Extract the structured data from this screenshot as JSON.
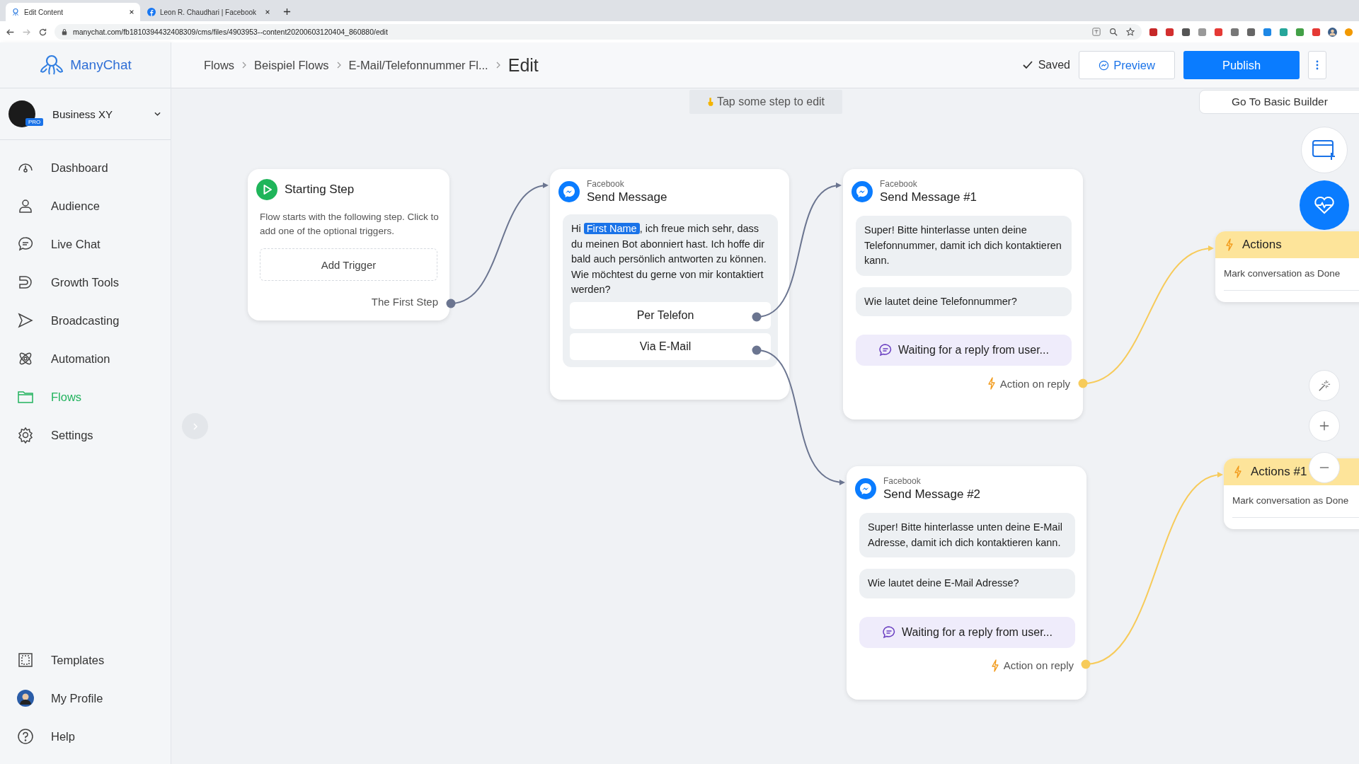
{
  "browser": {
    "tabs": [
      {
        "title": "Edit Content",
        "selected": true
      },
      {
        "title": "Leon R. Chaudhari | Facebook",
        "selected": false
      }
    ],
    "url": "manychat.com/fb1810394432408309/cms/files/4903953--content20200603120404_860880/edit"
  },
  "sidebar": {
    "brand": "ManyChat",
    "account": {
      "name": "Business XY",
      "badge": "PRO"
    },
    "items": [
      {
        "label": "Dashboard",
        "selected": false
      },
      {
        "label": "Audience",
        "selected": false
      },
      {
        "label": "Live Chat",
        "selected": false
      },
      {
        "label": "Growth Tools",
        "selected": false
      },
      {
        "label": "Broadcasting",
        "selected": false
      },
      {
        "label": "Automation",
        "selected": false
      },
      {
        "label": "Flows",
        "selected": true
      },
      {
        "label": "Settings",
        "selected": false
      }
    ],
    "bottom_items": [
      {
        "label": "Templates"
      },
      {
        "label": "My Profile"
      },
      {
        "label": "Help"
      }
    ]
  },
  "header": {
    "breadcrumbs": [
      "Flows",
      "Beispiel Flows",
      "E-Mail/Telefonnummer Fl..."
    ],
    "current": "Edit",
    "status": "Saved",
    "preview": "Preview",
    "publish": "Publish"
  },
  "canvas": {
    "hint": "Tap some step to edit",
    "basic_builder": "Go To Basic Builder",
    "nodes": [
      {
        "kind": "start",
        "title": "Starting Step",
        "description": "Flow starts with the following step. Click to add one of the optional triggers.",
        "trigger": "Add Trigger",
        "output": "The First Step"
      },
      {
        "kind": "message",
        "channel": "Facebook",
        "title": "Send Message",
        "blocks": [
          {
            "kind": "text",
            "parts": [
              {
                "kind": "plain",
                "text": "Hi "
              },
              {
                "kind": "variable",
                "text": "First Name"
              },
              {
                "kind": "plain",
                "text": ", ich freue mich sehr, dass du meinen Bot abonniert hast. Ich hoffe dir bald auch persönlich antworten zu können. Wie möchtest du gerne von mir kontaktiert werden?"
              }
            ],
            "buttons": [
              "Per Telefon",
              "Via E-Mail"
            ]
          }
        ]
      },
      {
        "kind": "message",
        "channel": "Facebook",
        "title": "Send Message #1",
        "blocks": [
          {
            "kind": "text",
            "parts": [
              {
                "kind": "plain",
                "text": "Super! Bitte hinterlasse unten deine Telefonnummer, damit ich dich kontaktieren kann."
              }
            ]
          },
          {
            "kind": "text",
            "parts": [
              {
                "kind": "plain",
                "text": "Wie lautet deine Telefonnummer?"
              }
            ]
          },
          {
            "kind": "waiting",
            "text": "Waiting for a reply from user..."
          }
        ],
        "footer": "Action on reply"
      },
      {
        "kind": "message",
        "channel": "Facebook",
        "title": "Send Message #2",
        "blocks": [
          {
            "kind": "text",
            "parts": [
              {
                "kind": "plain",
                "text": "Super! Bitte hinterlasse unten deine E-Mail Adresse, damit ich dich kontaktieren kann."
              }
            ]
          },
          {
            "kind": "text",
            "parts": [
              {
                "kind": "plain",
                "text": "Wie lautet deine E-Mail Adresse?"
              }
            ]
          },
          {
            "kind": "waiting",
            "text": "Waiting for a reply from user..."
          }
        ],
        "footer": "Action on reply"
      },
      {
        "kind": "action",
        "title": "Actions",
        "items": [
          "Mark conversation as Done"
        ]
      },
      {
        "kind": "action",
        "title": "Actions #1",
        "items": [
          "Mark conversation as Done"
        ]
      }
    ]
  }
}
